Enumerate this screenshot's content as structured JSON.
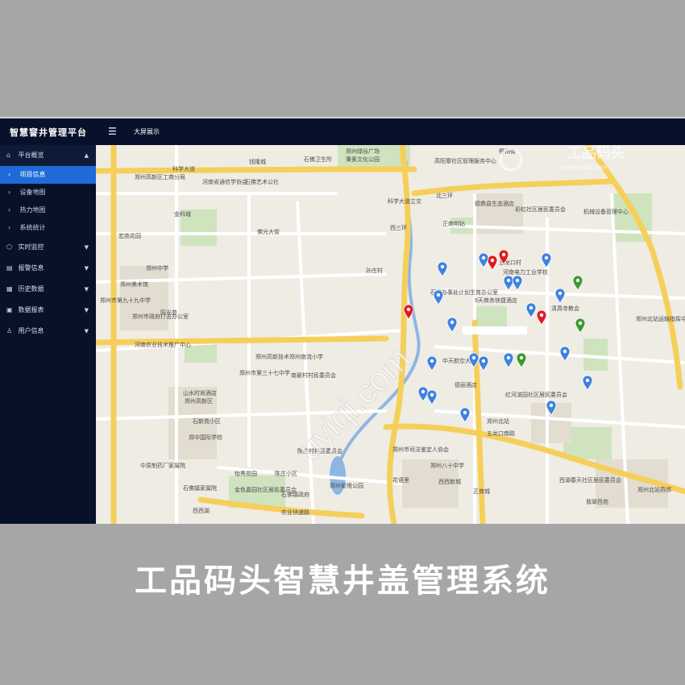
{
  "header": {
    "app_title": "智慧窨井管理平台",
    "menu_icon": "hamburger-icon",
    "screen_link": "大屏展示"
  },
  "sidebar": {
    "group_overview": {
      "label": "平台概览",
      "icon": "home-icon",
      "items": [
        "项目信息",
        "设备地图",
        "热力地图",
        "系统统计"
      ],
      "active": "项目信息"
    },
    "groups": [
      {
        "label": "实时监控",
        "icon": "cube-icon"
      },
      {
        "label": "报警信息",
        "icon": "alarm-icon"
      },
      {
        "label": "历史数据",
        "icon": "history-icon"
      },
      {
        "label": "数据报表",
        "icon": "report-icon"
      },
      {
        "label": "用户信息",
        "icon": "user-icon"
      }
    ]
  },
  "map": {
    "colors": {
      "blue_marker": "#3f82e0",
      "red_marker": "#e01a22",
      "green_marker": "#3a9a2e",
      "road_major": "#f6cf5a",
      "water": "#8fb6e3"
    },
    "labels": [
      "科学大道",
      "钱隆城",
      "郑州绿谷广场",
      "秉素文化公园",
      "石佛卫生所",
      "郑州高新区工商分局",
      "河南省通信学协会",
      "石佛艺术公社",
      "金科城",
      "宏苑花园",
      "北三环",
      "梧桐街",
      "科学大道立交",
      "西三环",
      "高阳寨社区管理服务中心",
      "德鼎县生态酒店",
      "正商明钻",
      "彩虹社区居民委员会",
      "机械设备管理中心",
      "佛光大街",
      "郑州中学",
      "郑州美术馆",
      "郑州市第九十九中学",
      "郑州市政府打击办公室",
      "阳光苑",
      "孙庄村",
      "五龙口村",
      "河南电力工业学校",
      "石佛办事处计划生育办公室",
      "9天商务快捷酒店",
      "清真寺教会",
      "郑州北站运输指挥中心",
      "河南农业技术推广中心",
      "郑州高新技术郑州南流小学",
      "郑州市第三十七中学",
      "南翟村村民委员会",
      "山水时尚酒店",
      "郑州高新区",
      "中天航空大厦",
      "德丽酒店",
      "石新苑小区",
      "郑中国际学校",
      "红河滨园社区居民委员会",
      "郑州北站",
      "中原制药厂家属院",
      "郑州市司法鉴定人协会",
      "陈庄村村民委员会",
      "怡秀花园",
      "陈庄小区",
      "石佛镇家属院",
      "金色嘉园社区居民委员会",
      "石佛镇政府",
      "郑州翟塔公园",
      "郑州八十中学",
      "花语里",
      "西西新城",
      "正商城",
      "西湖春天社区居民委员会",
      "五龙口南路",
      "翡翠西苑",
      "农业快速路",
      "西西湖",
      "郑州北站燕郊"
    ],
    "watermark": "uyiqi.com"
  },
  "logo": {
    "brand": "工品码头",
    "domain": "www.mosit.com"
  },
  "caption": "工品码头智慧井盖管理系统"
}
